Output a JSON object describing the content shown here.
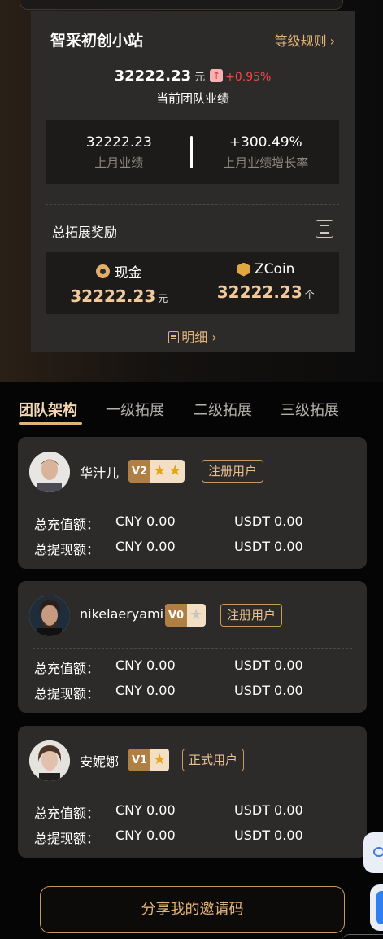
{
  "level": {
    "title": "智采初创小站",
    "rules_label": "等级规则",
    "team_performance": "32222.23",
    "team_performance_unit": "元",
    "team_performance_change": "+0.95%",
    "team_performance_label": "当前团队业绩",
    "last_month_value": "32222.23",
    "last_month_label": "上月业绩",
    "growth_value": "+300.49%",
    "growth_label": "上月业绩增长率"
  },
  "rewards": {
    "title": "总拓展奖励",
    "cash_label": "现金",
    "cash_value": "32222.23",
    "cash_unit": "元",
    "zcoin_label": "ZCoin",
    "zcoin_value": "32222.23",
    "zcoin_unit": "个",
    "detail_label": "明细"
  },
  "tabs": [
    {
      "label": "团队架构",
      "active": true
    },
    {
      "label": "一级拓展",
      "active": false
    },
    {
      "label": "二级拓展",
      "active": false
    },
    {
      "label": "三级拓展",
      "active": false
    }
  ],
  "labels": {
    "total_recharge": "总充值额：",
    "total_withdraw": "总提现额："
  },
  "members": [
    {
      "name": "华汁儿",
      "level": "V2",
      "stars_on": 2,
      "stars_total": 2,
      "tag": "注册用户",
      "recharge_cny": "CNY 0.00",
      "recharge_usdt": "USDT 0.00",
      "withdraw_cny": "CNY 0.00",
      "withdraw_usdt": "USDT 0.00"
    },
    {
      "name": "nikelaeryami",
      "level": "V0",
      "stars_on": 0,
      "stars_total": 1,
      "tag": "注册用户",
      "recharge_cny": "CNY 0.00",
      "recharge_usdt": "USDT 0.00",
      "withdraw_cny": "CNY 0.00",
      "withdraw_usdt": "USDT 0.00"
    },
    {
      "name": "安妮娜",
      "level": "V1",
      "stars_on": 1,
      "stars_total": 1,
      "tag": "正式用户",
      "recharge_cny": "CNY 0.00",
      "recharge_usdt": "USDT 0.00",
      "withdraw_cny": "CNY 0.00",
      "withdraw_usdt": "USDT 0.00"
    }
  ],
  "share_button": "分享我的邀请码",
  "icons": {
    "rules_chevron": "chevron-right-icon",
    "change_arrow": "arrow-up-icon",
    "list": "list-icon",
    "cash": "coin-icon",
    "zcoin": "zcoin-icon",
    "detail": "document-icon",
    "star": "star-icon"
  },
  "colors": {
    "accent": "#e2b378",
    "positive": "#ee4a4a",
    "card_bg": "#2c2b29"
  }
}
